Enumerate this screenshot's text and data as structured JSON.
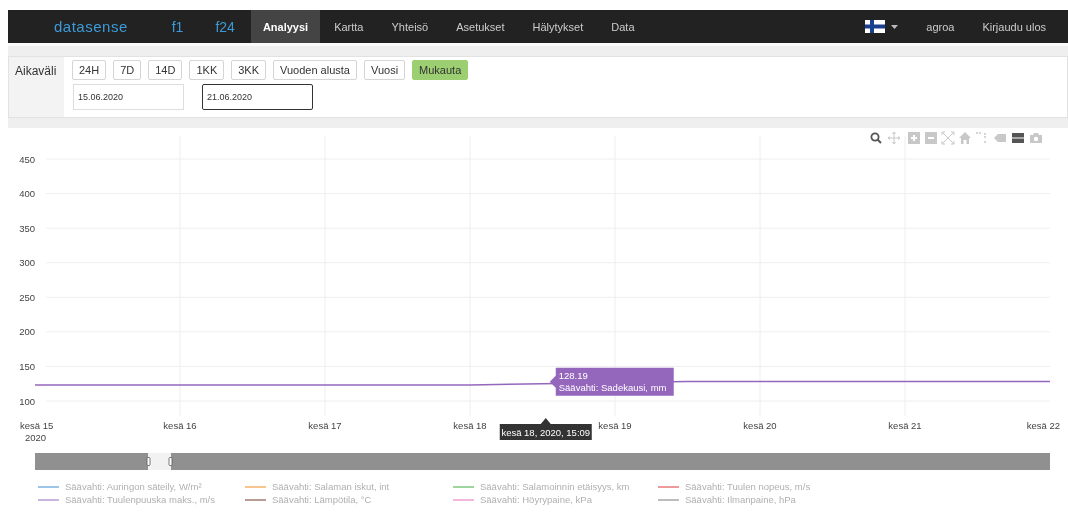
{
  "navbar": {
    "logo": "datasense",
    "items": [
      {
        "label": "f1",
        "kind": "brand",
        "selected": false
      },
      {
        "label": "f24",
        "kind": "brand",
        "selected": false
      },
      {
        "label": "Analyysi",
        "kind": "link",
        "selected": true
      },
      {
        "label": "Kartta",
        "kind": "link",
        "selected": false
      },
      {
        "label": "Yhteisö",
        "kind": "link",
        "selected": false
      },
      {
        "label": "Asetukset",
        "kind": "link",
        "selected": false
      },
      {
        "label": "Hälytykset",
        "kind": "link",
        "selected": false
      },
      {
        "label": "Data",
        "kind": "link",
        "selected": false
      }
    ],
    "user": "agroa",
    "logout": "Kirjaudu ulos"
  },
  "time_range": {
    "label": "Aikaväli",
    "presets": [
      {
        "label": "24H",
        "selected": false
      },
      {
        "label": "7D",
        "selected": false
      },
      {
        "label": "14D",
        "selected": false
      },
      {
        "label": "1KK",
        "selected": false
      },
      {
        "label": "3KK",
        "selected": false
      },
      {
        "label": "Vuoden alusta",
        "selected": false
      },
      {
        "label": "Vuosi",
        "selected": false
      },
      {
        "label": "Mukauta",
        "selected": true
      }
    ],
    "start_date": {
      "value": "15.06.2020",
      "focused": false
    },
    "end_date": {
      "value": "21.06.2020",
      "focused": true
    }
  },
  "chart": {
    "chart_data": {
      "type": "line",
      "categories": [
        "kesä 15",
        null,
        "kesä 16",
        null,
        "kesä 17",
        null,
        "kesä 18",
        null,
        "kesä 19",
        null,
        "kesä 20",
        null,
        "kesä 21",
        null,
        "kesä 22"
      ],
      "series": [
        {
          "name": "Säävahti: Sadekausi, mm",
          "color": "#9467bd",
          "values": [
            123,
            123,
            123,
            123,
            123,
            123,
            123,
            125,
            null,
            128,
            128,
            128,
            128,
            128,
            128
          ]
        }
      ],
      "grid": true,
      "ylim": [
        100,
        450
      ],
      "yticks": [
        100,
        150,
        200,
        250,
        300,
        350,
        400,
        450
      ]
    },
    "xtick_year": "2020",
    "hover_label": {
      "value": "128.19"
    },
    "x_hover_label": "kesä 18, 2020, 15:09",
    "modebar": [
      {
        "kind": "zoom",
        "selected": true
      },
      {
        "kind": "pan",
        "selected": false
      },
      {
        "kind": "zoom-in",
        "selected": false
      },
      {
        "kind": "zoom-out",
        "selected": false
      },
      {
        "kind": "autoscale",
        "selected": false
      },
      {
        "kind": "home",
        "selected": false
      },
      {
        "kind": "spikelines",
        "selected": false
      },
      {
        "kind": "hover-closest",
        "selected": false
      },
      {
        "kind": "hover-compare",
        "selected": true
      },
      {
        "kind": "camera",
        "selected": false
      }
    ]
  },
  "legend": [
    {
      "label": "Säävahti: Auringon säteily, W/m²",
      "color": "#9ec5e8"
    },
    {
      "label": "Säävahti: Salaman iskut, int",
      "color": "#f9c58f"
    },
    {
      "label": "Säävahti: Salamoinnin etäisyys, km",
      "color": "#9fd59f"
    },
    {
      "label": "Säävahti: Tuulen nopeus, m/s",
      "color": "#ee9a9a"
    },
    {
      "label": "Säävahti: Tuulenpuuska maks., m/s",
      "color": "#c9b5e0"
    },
    {
      "label": "Säävahti: Lämpötila, °C",
      "color": "#b79d96"
    },
    {
      "label": "Säävahti: Höyrypaine, kPa",
      "color": "#f2b8df"
    },
    {
      "label": "Säävahti: Ilmanpaine, hPa",
      "color": "#bdbdbd"
    }
  ]
}
